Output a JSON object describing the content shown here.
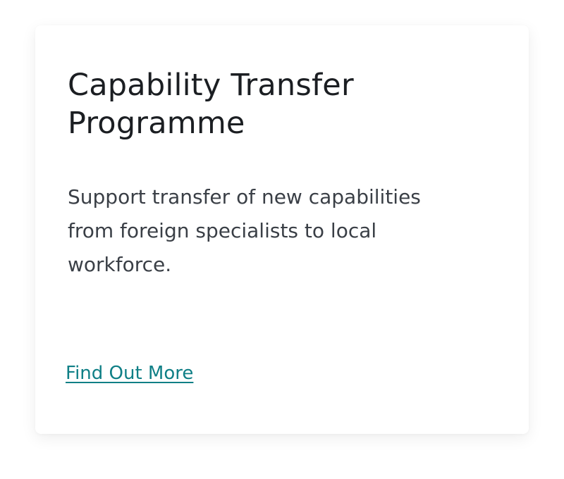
{
  "card": {
    "title": "Capability Transfer Programme",
    "description": "Support transfer of new capabilities from foreign specialists to local workforce.",
    "link_label": "Find Out More"
  },
  "colors": {
    "title": "#1b1e22",
    "description": "#3a3f46",
    "link": "#0f7f86",
    "card_background": "#ffffff"
  }
}
